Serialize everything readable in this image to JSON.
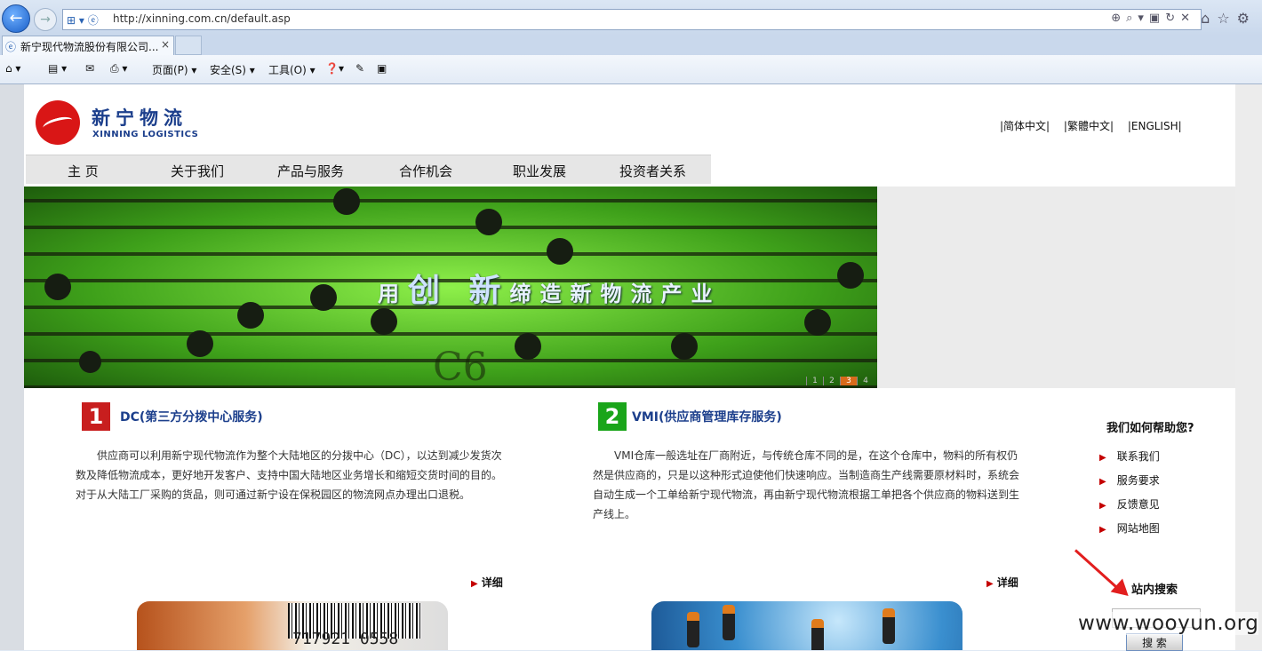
{
  "browser": {
    "url": "http://xinning.com.cn/default.asp",
    "tab_title": "新宁现代物流股份有限公司...",
    "tab_close": "×",
    "back_glyph": "←",
    "forward_glyph": "→",
    "commands": [
      "页面(P) ▾",
      "安全(S) ▾",
      "工具(O) ▾"
    ]
  },
  "header": {
    "logo_cn": "新宁物流",
    "logo_en": "XINNING LOGISTICS",
    "lang_links": [
      "|简体中文|",
      "|繁體中文|",
      "|ENGLISH|"
    ]
  },
  "nav": {
    "items": [
      "主 页",
      "关于我们",
      "产品与服务",
      "合作机会",
      "职业发展",
      "投资者关系"
    ]
  },
  "banner": {
    "slogan_1": "用",
    "slogan_2": "创 新",
    "slogan_3": "缔造新物流产业",
    "slide_numbers": [
      "1",
      "2",
      "3",
      "4"
    ],
    "active_slide": "3",
    "chip_text": "C6"
  },
  "sections": [
    {
      "number": "1",
      "title": "DC(第三方分拨中心服务)",
      "body": "　　供应商可以利用新宁现代物流作为整个大陆地区的分拨中心（DC），以达到减少发货次数及降低物流成本，更好地开发客户、支持中国大陆地区业务增长和缩短交货时间的目的。对于从大陆工厂采购的货品，则可通过新宁设在保税园区的物流网点办理出口退税。",
      "detail": "详细",
      "badge_color": "#c81e1e"
    },
    {
      "number": "2",
      "title": "VMI(供应商管理库存服务)",
      "body": "　　VMI仓库一般选址在厂商附近，与传统仓库不同的是，在这个仓库中，物料的所有权仍然是供应商的，只是以这种形式迫使他们快速响应。当制造商生产线需要原材料时，系统会自动生成一个工单给新宁现代物流，再由新宁现代物流根据工单把各个供应商的物料送到生产线上。",
      "detail": "详细",
      "badge_color": "#1aa51a"
    }
  ],
  "help": {
    "title": "我们如何帮助您?",
    "links": [
      "联系我们",
      "服务要求",
      "反馈意见",
      "网站地图"
    ]
  },
  "search": {
    "title": "站内搜索",
    "input_value": "",
    "button_label": "搜 索"
  },
  "images": {
    "barcode_number": "717921 0558"
  },
  "watermark": "www.wooyun.org"
}
